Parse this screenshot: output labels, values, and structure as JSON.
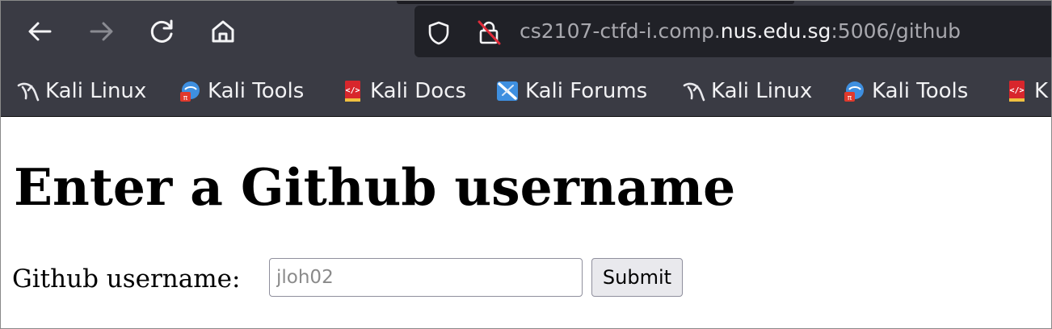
{
  "toolbar": {
    "back_icon": "arrow-left-icon",
    "forward_icon": "arrow-right-icon",
    "reload_icon": "reload-icon",
    "home_icon": "home-icon"
  },
  "address_bar": {
    "url_prefix": "cs2107-ctfd-i.comp.",
    "url_host": "nus.edu.sg",
    "url_suffix": ":5006/github",
    "shield_icon": "tracking-protection-shield-icon",
    "lock_icon": "insecure-lock-icon"
  },
  "bookmarks": [
    {
      "label": "Kali Linux",
      "icon": "kali-dragon-icon"
    },
    {
      "label": "Kali Tools",
      "icon": "kali-tools-icon"
    },
    {
      "label": "Kali Docs",
      "icon": "kali-docs-icon"
    },
    {
      "label": "Kali Forums",
      "icon": "kali-forums-icon"
    },
    {
      "label": "Kali Linux",
      "icon": "kali-dragon-icon"
    },
    {
      "label": "Kali Tools",
      "icon": "kali-tools-icon"
    },
    {
      "label": "K",
      "icon": "kali-docs-icon"
    }
  ],
  "page": {
    "title": "Enter a Github username",
    "form": {
      "label": "Github username:",
      "input_placeholder": "jloh02",
      "input_value": "",
      "submit_label": "Submit"
    }
  },
  "colors": {
    "toolbar_bg": "#3a3b44",
    "urlbar_bg": "#202127",
    "page_bg": "#ffffff"
  }
}
